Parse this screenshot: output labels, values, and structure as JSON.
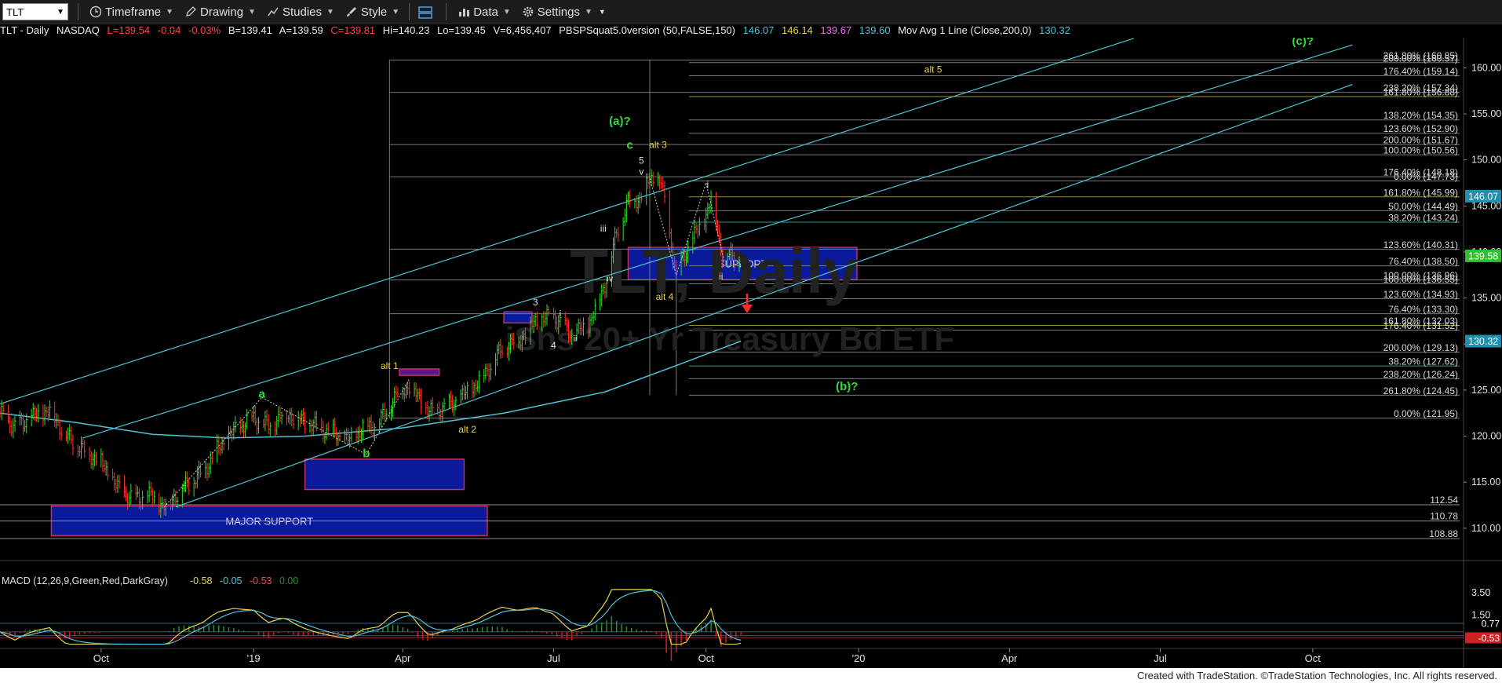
{
  "toolbar": {
    "symbol": "TLT",
    "items": [
      {
        "label": "Timeframe",
        "icon": "clock-icon"
      },
      {
        "label": "Drawing",
        "icon": "pencil-icon"
      },
      {
        "label": "Studies",
        "icon": "studies-icon"
      },
      {
        "label": "Style",
        "icon": "brush-icon"
      },
      {
        "label": "Data",
        "icon": "data-icon"
      },
      {
        "label": "Settings",
        "icon": "gear-icon"
      }
    ]
  },
  "infobar": {
    "symbol": "TLT - Daily",
    "exchange": "NASDAQ",
    "last": "L=139.54",
    "change": "-0.04",
    "change_pct": "-0.03%",
    "bid": "B=139.41",
    "ask": "A=139.59",
    "close": "C=139.81",
    "high": "Hi=140.23",
    "low": "Lo=139.45",
    "volume": "V=6,456,407",
    "study1": "PBSPSquat5.0version (50,FALSE,150)",
    "study1_v1": "146.07",
    "study1_v2": "146.14",
    "study1_v3": "139.67",
    "study1_v4": "139.60",
    "study2": "Mov Avg 1 Line (Close,200,0)",
    "study2_v1": "130.32"
  },
  "colors": {
    "up": "#33dd33",
    "down": "#ff3333",
    "channel": "#4fc3d8",
    "support_fill": "#0a1a9a",
    "wave_green": "#33dd33",
    "wave_yellow": "#e8d44a",
    "wave_white": "#e0e0e0"
  },
  "chart_data": {
    "type": "line",
    "title": "TLT Daily",
    "watermark_line1": "TLT, Daily",
    "watermark_line2": "iShs 20+ Yr Treasury Bd ETF",
    "x_range": [
      "2018-08-01",
      "2020-12-31"
    ],
    "ylim": [
      107,
      162
    ],
    "x_ticks": [
      {
        "label": "Oct",
        "date": "2018-10-01"
      },
      {
        "label": "'19",
        "date": "2019-01-01"
      },
      {
        "label": "Apr",
        "date": "2019-04-01"
      },
      {
        "label": "Jul",
        "date": "2019-07-01"
      },
      {
        "label": "Oct",
        "date": "2019-10-01"
      },
      {
        "label": "'20",
        "date": "2020-01-01"
      },
      {
        "label": "Apr",
        "date": "2020-04-01"
      },
      {
        "label": "Jul",
        "date": "2020-07-01"
      },
      {
        "label": "Oct",
        "date": "2020-10-01"
      }
    ],
    "y_ticks": [
      110,
      115,
      120,
      125,
      130,
      135,
      140,
      145,
      150,
      155,
      160
    ],
    "price_series": [
      [
        "2018-08-01",
        122.5
      ],
      [
        "2018-08-10",
        121.0
      ],
      [
        "2018-08-20",
        122.0
      ],
      [
        "2018-08-31",
        122.8
      ],
      [
        "2018-09-10",
        120.0
      ],
      [
        "2018-09-20",
        118.5
      ],
      [
        "2018-10-01",
        117.2
      ],
      [
        "2018-10-10",
        114.5
      ],
      [
        "2018-10-20",
        113.2
      ],
      [
        "2018-10-31",
        113.5
      ],
      [
        "2018-11-08",
        112.3
      ],
      [
        "2018-11-20",
        114.5
      ],
      [
        "2018-12-01",
        116.0
      ],
      [
        "2018-12-10",
        118.5
      ],
      [
        "2018-12-20",
        120.5
      ],
      [
        "2019-01-01",
        122.0
      ],
      [
        "2019-01-10",
        121.0
      ],
      [
        "2019-01-20",
        122.5
      ],
      [
        "2019-02-01",
        121.5
      ],
      [
        "2019-02-15",
        120.5
      ],
      [
        "2019-02-28",
        119.5
      ],
      [
        "2019-03-08",
        120.8
      ],
      [
        "2019-03-18",
        121.5
      ],
      [
        "2019-03-28",
        124.5
      ],
      [
        "2019-04-05",
        125.5
      ],
      [
        "2019-04-17",
        122.5
      ],
      [
        "2019-05-01",
        123.5
      ],
      [
        "2019-05-15",
        125.5
      ],
      [
        "2019-05-31",
        129.5
      ],
      [
        "2019-06-10",
        130.5
      ],
      [
        "2019-06-20",
        132.5
      ],
      [
        "2019-07-01",
        133.0
      ],
      [
        "2019-07-12",
        131.0
      ],
      [
        "2019-07-22",
        132.0
      ],
      [
        "2019-08-01",
        136.5
      ],
      [
        "2019-08-08",
        142.0
      ],
      [
        "2019-08-15",
        145.5
      ],
      [
        "2019-08-22",
        145.8
      ],
      [
        "2019-08-28",
        148.0
      ],
      [
        "2019-09-04",
        147.5
      ],
      [
        "2019-09-13",
        137.5
      ],
      [
        "2019-09-20",
        140.5
      ],
      [
        "2019-10-01",
        144.0
      ],
      [
        "2019-10-04",
        145.8
      ],
      [
        "2019-10-11",
        139.8
      ],
      [
        "2019-10-18",
        139.3
      ],
      [
        "2019-10-22",
        139.58
      ]
    ],
    "ma_series": [
      [
        "2018-08-01",
        122.5
      ],
      [
        "2018-09-15",
        121.5
      ],
      [
        "2018-11-01",
        120.2
      ],
      [
        "2018-12-15",
        119.8
      ],
      [
        "2019-02-01",
        120.0
      ],
      [
        "2019-04-01",
        120.9
      ],
      [
        "2019-06-01",
        122.5
      ],
      [
        "2019-08-01",
        124.8
      ],
      [
        "2019-09-15",
        127.8
      ],
      [
        "2019-10-22",
        130.32
      ]
    ],
    "channel_lines": [
      {
        "from": [
          "2018-08-01",
          123.5
        ],
        "to": [
          "2020-06-15",
          163.2
        ]
      },
      {
        "from": [
          "2018-09-20",
          119.8
        ],
        "to": [
          "2020-10-25",
          162.5
        ]
      },
      {
        "from": [
          "2018-11-15",
          112.3
        ],
        "to": [
          "2020-10-25",
          158.2
        ]
      }
    ],
    "fib_levels": [
      {
        "label": "261.80% (160.85)",
        "value": 160.85
      },
      {
        "label": "200.00% (160.57)",
        "value": 160.57
      },
      {
        "label": "176.40% (159.14)",
        "value": 159.14
      },
      {
        "label": "238.20% (157.34)",
        "value": 157.34
      },
      {
        "label": "161.80% (156.88)",
        "value": 156.88
      },
      {
        "label": "138.20% (154.35)",
        "value": 154.35
      },
      {
        "label": "123.60% (152.90)",
        "value": 152.9
      },
      {
        "label": "200.00% (151.67)",
        "value": 151.67
      },
      {
        "label": "100.00% (150.56)",
        "value": 150.56
      },
      {
        "label": "176.40% (148.18)",
        "value": 148.18
      },
      {
        "label": "0.00% (147.73)",
        "value": 147.73
      },
      {
        "label": "161.80% (145.99)",
        "value": 145.99
      },
      {
        "label": "50.00% (144.49)",
        "value": 144.49
      },
      {
        "label": "38.20% (143.24)",
        "value": 143.24
      },
      {
        "label": "123.60% (140.31)",
        "value": 140.31
      },
      {
        "label": "76.40% (138.50)",
        "value": 138.5
      },
      {
        "label": "100.00% (136.96)",
        "value": 136.96
      },
      {
        "label": "100.00% (136.55)",
        "value": 136.55
      },
      {
        "label": "123.60% (134.93)",
        "value": 134.93
      },
      {
        "label": "76.40% (133.30)",
        "value": 133.3
      },
      {
        "label": "161.80% (132.03)",
        "value": 132.03
      },
      {
        "label": "176.40% (131.52)",
        "value": 131.52
      },
      {
        "label": "200.00% (129.13)",
        "value": 129.13
      },
      {
        "label": "38.20% (127.62)",
        "value": 127.62
      },
      {
        "label": "238.20% (126.24)",
        "value": 126.24
      },
      {
        "label": "261.80% (124.45)",
        "value": 124.45
      },
      {
        "label": "0.00% (121.95)",
        "value": 121.95
      }
    ],
    "support_lines": [
      {
        "label": "112.54",
        "value": 112.54
      },
      {
        "label": "110.78",
        "value": 110.78
      },
      {
        "label": "108.88",
        "value": 108.88
      }
    ],
    "boxes": [
      {
        "name": "support-box",
        "label": "SUPPORT",
        "x0": "2019-08-15",
        "x1": "2019-12-31",
        "y0": 137.0,
        "y1": 140.5
      },
      {
        "name": "major-support-box",
        "label": "MAJOR SUPPORT",
        "x0": "2018-09-01",
        "x1": "2019-05-22",
        "y0": 109.2,
        "y1": 112.4
      },
      {
        "name": "b-support-box",
        "label": "",
        "x0": "2019-02-01",
        "x1": "2019-05-08",
        "y0": 114.2,
        "y1": 117.5
      },
      {
        "name": "wave3-box",
        "label": "",
        "x0": "2019-06-01",
        "x1": "2019-06-18",
        "y0": 132.3,
        "y1": 133.5
      },
      {
        "name": "alt1-box",
        "label": "",
        "x0": "2019-03-30",
        "x1": "2019-04-23",
        "y0": 126.6,
        "y1": 127.3
      }
    ],
    "annotations": [
      {
        "text": "(a)?",
        "date": "2019-08-10",
        "price": 153.8,
        "color": "wave_green",
        "size": 15
      },
      {
        "text": "c",
        "date": "2019-08-16",
        "price": 151.2,
        "color": "wave_green",
        "size": 15
      },
      {
        "text": "5",
        "date": "2019-08-23",
        "price": 149.6,
        "color": "wave_white",
        "size": 12
      },
      {
        "text": "v",
        "date": "2019-08-23",
        "price": 148.4,
        "color": "wave_white",
        "size": 12
      },
      {
        "text": "alt 3",
        "date": "2019-09-02",
        "price": 151.3,
        "color": "wave_yellow",
        "size": 12
      },
      {
        "text": "iii",
        "date": "2019-07-31",
        "price": 142.2,
        "color": "wave_white",
        "size": 12
      },
      {
        "text": "iv",
        "date": "2019-08-04",
        "price": 136.8,
        "color": "wave_white",
        "size": 11
      },
      {
        "text": "i",
        "date": "2019-10-02",
        "price": 147.0,
        "color": "wave_white",
        "size": 12
      },
      {
        "text": "ii",
        "date": "2019-10-10",
        "price": 137.0,
        "color": "wave_white",
        "size": 12
      },
      {
        "text": "alt 4",
        "date": "2019-09-06",
        "price": 134.8,
        "color": "wave_yellow",
        "size": 12
      },
      {
        "text": "3",
        "date": "2019-06-20",
        "price": 134.2,
        "color": "wave_white",
        "size": 12
      },
      {
        "text": "4",
        "date": "2019-07-01",
        "price": 129.5,
        "color": "wave_white",
        "size": 12
      },
      {
        "text": "ii",
        "date": "2019-07-14",
        "price": 130.3,
        "color": "wave_white",
        "size": 11
      },
      {
        "text": "i",
        "date": "2019-07-05",
        "price": 133.0,
        "color": "wave_white",
        "size": 11
      },
      {
        "text": "alt 1",
        "date": "2019-03-24",
        "price": 127.3,
        "color": "wave_yellow",
        "size": 12
      },
      {
        "text": "a",
        "date": "2019-01-06",
        "price": 124.2,
        "color": "wave_green",
        "size": 15
      },
      {
        "text": "b",
        "date": "2019-03-10",
        "price": 117.7,
        "color": "wave_green",
        "size": 15
      },
      {
        "text": "alt 2",
        "date": "2019-05-10",
        "price": 120.4,
        "color": "wave_yellow",
        "size": 12
      },
      {
        "text": "alt 5",
        "date": "2020-02-15",
        "price": 159.5,
        "color": "wave_yellow",
        "size": 12
      },
      {
        "text": "(c)?",
        "date": "2020-09-25",
        "price": 162.5,
        "color": "wave_green",
        "size": 15
      },
      {
        "text": "(b)?",
        "date": "2019-12-25",
        "price": 125.0,
        "color": "wave_green",
        "size": 15
      }
    ],
    "last_price_labels": [
      {
        "label": "146.07",
        "value": 146.07,
        "bg": "#1e8fb0"
      },
      {
        "label": "139.58",
        "value": 139.58,
        "bg": "#2fbf2f"
      },
      {
        "label": "130.32",
        "value": 130.32,
        "bg": "#1e8fb0"
      }
    ]
  },
  "macd": {
    "title": "MACD (12,26,9,Green,Red,DarkGray)",
    "v1": "-0.58",
    "v2": "-0.05",
    "v3": "-0.53",
    "v4": "0.00",
    "ylim": [
      -1.2,
      4.0
    ],
    "y_ticks": [
      3.5,
      1.5
    ],
    "right_labels": [
      {
        "label": "0.77",
        "value": 0.77
      },
      {
        "label": "-0.34",
        "value": -0.34
      },
      {
        "label": "-0.53",
        "value": -0.53
      }
    ]
  },
  "footer": {
    "text": "Created with TradeStation. ©TradeStation Technologies, Inc. All rights reserved."
  }
}
